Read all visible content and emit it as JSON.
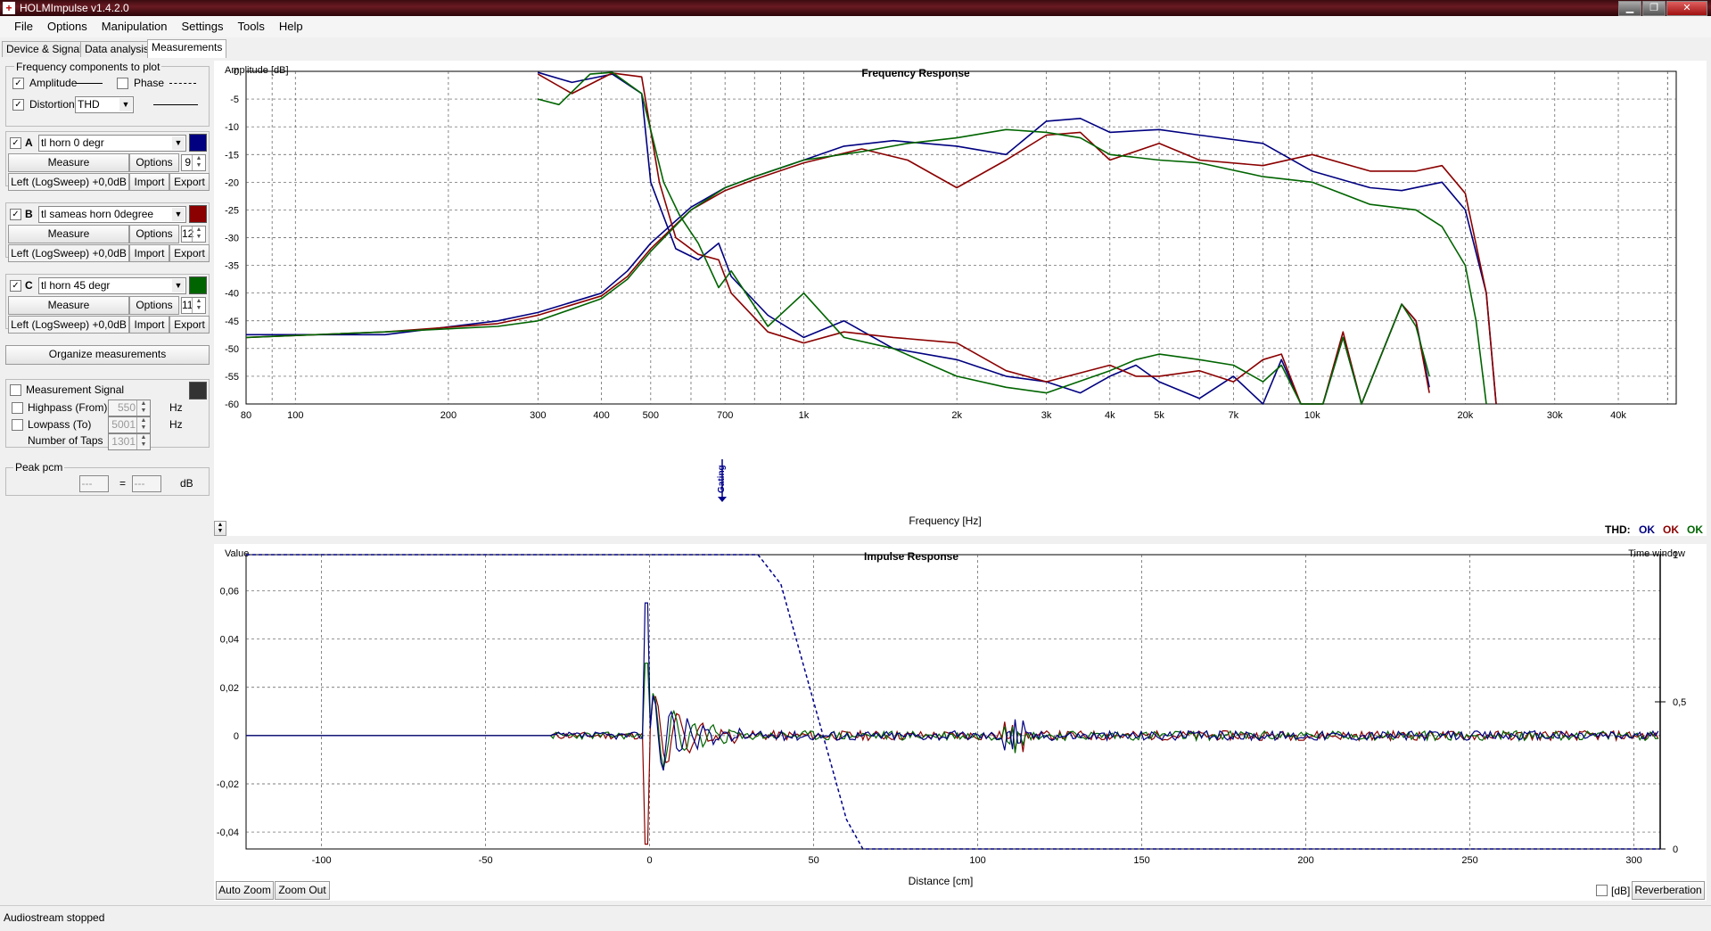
{
  "window": {
    "title": "HOLMImpulse  v1.4.2.0"
  },
  "menu": [
    "File",
    "Options",
    "Manipulation",
    "Settings",
    "Tools",
    "Help"
  ],
  "tabs": [
    "Device & Signal",
    "Data analysis",
    "Measurements"
  ],
  "freq_components": {
    "title": "Frequency components to plot",
    "amplitude_label": "Amplitude",
    "phase_label": "Phase",
    "distortion_label": "Distortion",
    "distortion_value": "THD",
    "amplitude_checked": true,
    "phase_checked": false,
    "distortion_checked": true
  },
  "measurements": [
    {
      "letter": "A",
      "name": "tl horn 0 degr",
      "color": "#000080",
      "measure_label": "Measure",
      "options_label": "Options",
      "spin": "9",
      "channel": "Left (LogSweep) +0,0dB",
      "import_label": "Import",
      "export_label": "Export"
    },
    {
      "letter": "B",
      "name": "tl sameas horn 0degree",
      "color": "#8b0000",
      "measure_label": "Measure",
      "options_label": "Options",
      "spin": "12",
      "channel": "Left (LogSweep) +0,0dB",
      "import_label": "Import",
      "export_label": "Export"
    },
    {
      "letter": "C",
      "name": "tl horn 45 degr",
      "color": "#006400",
      "measure_label": "Measure",
      "options_label": "Options",
      "spin": "11",
      "channel": "Left (LogSweep) +0,0dB",
      "import_label": "Import",
      "export_label": "Export"
    }
  ],
  "organize_label": "Organize measurements",
  "signal": {
    "title": "Measurement Signal",
    "highpass_label": "Highpass (From)",
    "highpass_value": "550",
    "lowpass_label": "Lowpass (To)",
    "lowpass_value": "5001",
    "taps_label": "Number of Taps",
    "taps_value": "1301",
    "hz": "Hz"
  },
  "peak": {
    "title": "Peak pcm",
    "left": "---",
    "eq": "=",
    "right": "---",
    "unit": "dB"
  },
  "freq_chart": {
    "title": "Frequency Response",
    "ylabel": "Amplitude [dB]",
    "xlabel": "Frequency [Hz]",
    "yticks": [
      "0",
      "-5",
      "-10",
      "-15",
      "-20",
      "-25",
      "-30",
      "-35",
      "-40",
      "-45",
      "-50",
      "-55",
      "-60"
    ],
    "xticks": [
      "80",
      "100",
      "200",
      "300",
      "400",
      "500",
      "700",
      "1k",
      "2k",
      "3k",
      "4k",
      "5k",
      "7k",
      "10k",
      "20k",
      "30k",
      "40k"
    ],
    "gating_label": "Gating",
    "thd_label": "THD:",
    "thd_status": [
      "OK",
      "OK",
      "OK"
    ]
  },
  "impulse_chart": {
    "title": "Impulse Response",
    "ylabel": "Value",
    "right_label": "Time window",
    "xlabel": "Distance [cm]",
    "yticks": [
      "0,06",
      "0,04",
      "0,02",
      "0",
      "-0,02",
      "-0,04"
    ],
    "xticks": [
      "-100",
      "-50",
      "0",
      "50",
      "100",
      "150",
      "200",
      "250",
      "300"
    ],
    "right_ticks": [
      "1",
      "0,5",
      "0"
    ]
  },
  "bottom": {
    "auto_zoom": "Auto Zoom",
    "zoom_out": "Zoom Out",
    "db_label": "[dB]",
    "reverberation": "Reverberation"
  },
  "status": "Audiostream stopped"
}
